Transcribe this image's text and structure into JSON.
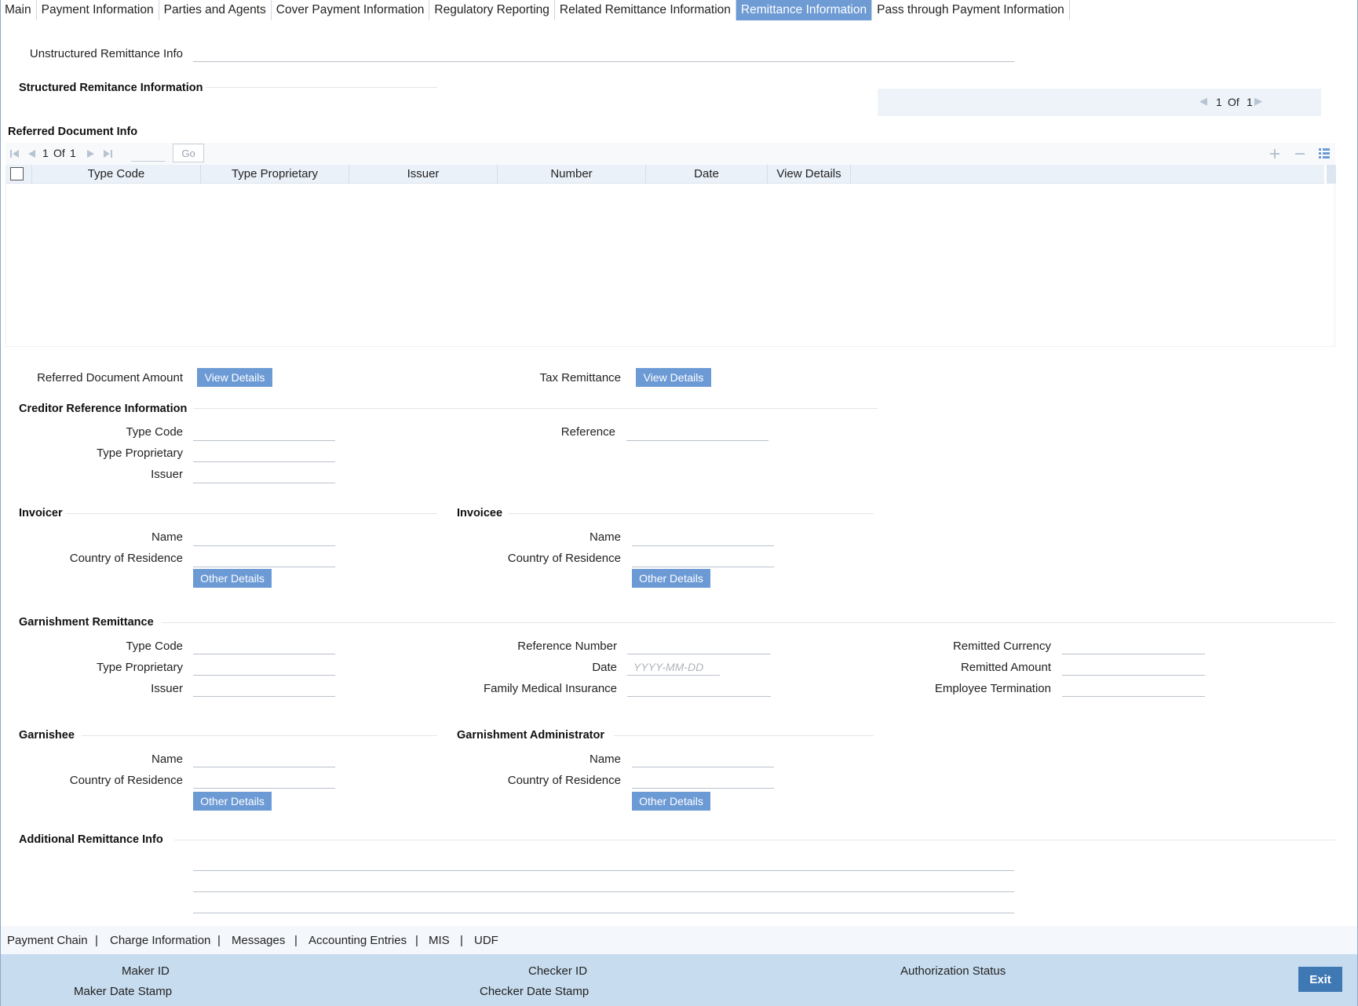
{
  "tabs": [
    {
      "label": "Main"
    },
    {
      "label": "Payment Information"
    },
    {
      "label": "Parties and Agents"
    },
    {
      "label": "Cover Payment Information"
    },
    {
      "label": "Regulatory Reporting"
    },
    {
      "label": "Related Remittance Information"
    },
    {
      "label": "Remittance Information"
    },
    {
      "label": "Pass through Payment Information"
    }
  ],
  "unstructured": {
    "label": "Unstructured Remittance Info",
    "value": ""
  },
  "structured": {
    "title": "Structured Remitance Information",
    "pager": {
      "current": "1",
      "of": "Of",
      "total": "1"
    }
  },
  "referred_doc": {
    "title": "Referred Document Info",
    "pager": {
      "current": "1",
      "of": "Of",
      "total": "1",
      "go_label": "Go",
      "page_input": ""
    },
    "columns": [
      "Type Code",
      "Type Proprietary",
      "Issuer",
      "Number",
      "Date",
      "View Details"
    ]
  },
  "referred_amount": {
    "label": "Referred Document Amount",
    "button": "View Details"
  },
  "tax_remittance": {
    "label": "Tax Remittance",
    "button": "View Details"
  },
  "creditor_ref": {
    "title": "Creditor Reference Information",
    "type_code": "Type Code",
    "type_proprietary": "Type Proprietary",
    "issuer": "Issuer",
    "reference": "Reference"
  },
  "invoicer": {
    "title": "Invoicer",
    "name": "Name",
    "country": "Country of Residence",
    "button": "Other Details"
  },
  "invoicee": {
    "title": "Invoicee",
    "name": "Name",
    "country": "Country of Residence",
    "button": "Other Details"
  },
  "garnishment": {
    "title": "Garnishment Remittance",
    "type_code": "Type Code",
    "type_proprietary": "Type Proprietary",
    "issuer": "Issuer",
    "reference_number": "Reference Number",
    "date": "Date",
    "date_placeholder": "YYYY-MM-DD",
    "family_medical": "Family Medical Insurance",
    "remitted_currency": "Remitted Currency",
    "remitted_amount": "Remitted Amount",
    "employee_termination": "Employee Termination"
  },
  "garnishee": {
    "title": "Garnishee",
    "name": "Name",
    "country": "Country of Residence",
    "button": "Other Details"
  },
  "garnishment_admin": {
    "title": "Garnishment Administrator",
    "name": "Name",
    "country": "Country of Residence",
    "button": "Other Details"
  },
  "additional": {
    "title": "Additional Remittance Info"
  },
  "bottom_links": [
    "Payment Chain",
    "Charge Information",
    "Messages",
    "Accounting Entries",
    "MIS",
    "UDF"
  ],
  "bottom_sep": "|",
  "footer": {
    "maker_id": "Maker ID",
    "maker_date": "Maker Date Stamp",
    "checker_id": "Checker ID",
    "checker_date": "Checker Date Stamp",
    "auth_status": "Authorization Status",
    "exit": "Exit"
  },
  "colors": {
    "active_tab": "#6e9bd4",
    "button": "#6c9ad5",
    "footer": "#c7dcef",
    "exit": "#3f79b4"
  }
}
